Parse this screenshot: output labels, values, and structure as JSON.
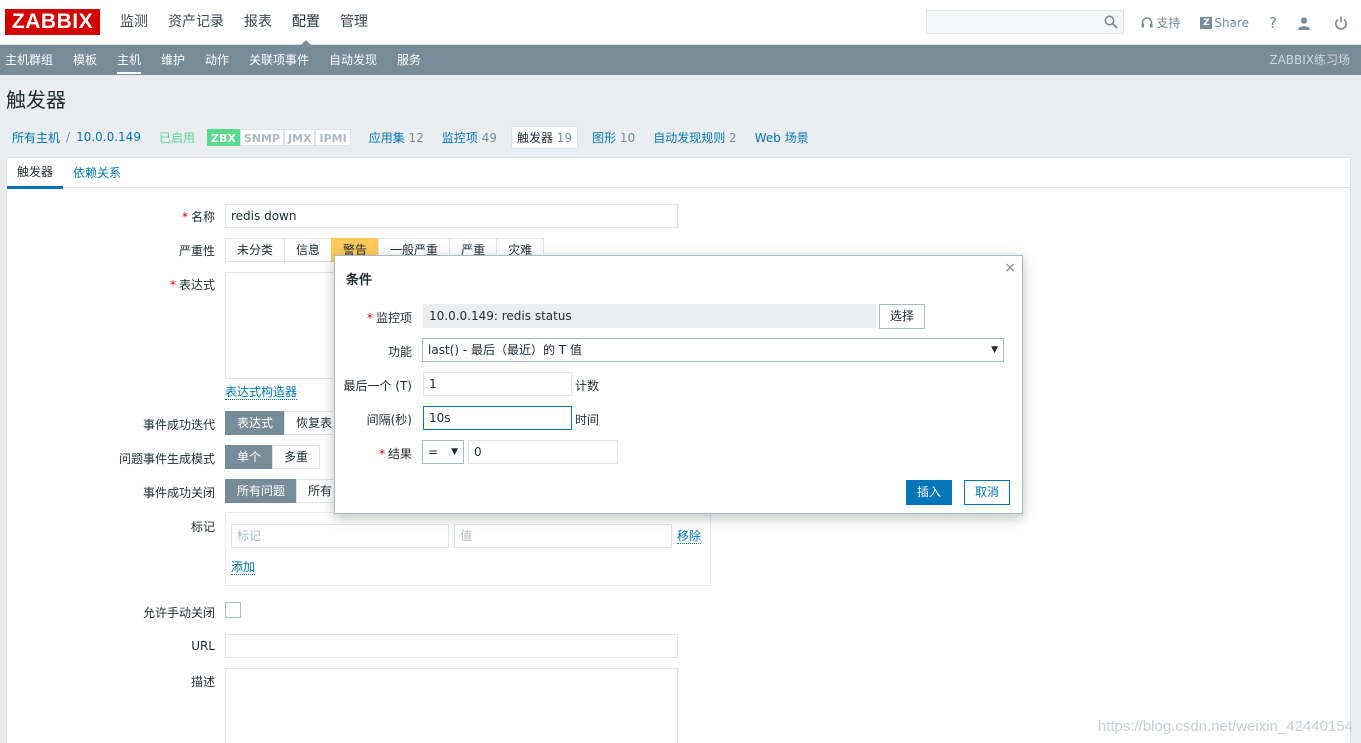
{
  "header": {
    "logo": "ZABBIX",
    "menu": [
      "监测",
      "资产记录",
      "报表",
      "配置",
      "管理"
    ],
    "support": "支持",
    "share": "Share",
    "share_letter": "Z",
    "help": "?"
  },
  "submenu": {
    "items": [
      "主机群组",
      "模板",
      "主机",
      "维护",
      "动作",
      "关联项事件",
      "自动发现",
      "服务"
    ],
    "brand": "ZABBIX练习场"
  },
  "page": {
    "title": "触发器"
  },
  "breadcrumbs": {
    "all_hosts": "所有主机",
    "sep": "/",
    "host": "10.0.0.149",
    "status": "已启用",
    "tags": [
      "ZBX",
      "SNMP",
      "JMX",
      "IPMI"
    ],
    "links": [
      {
        "label": "应用集",
        "count": "12"
      },
      {
        "label": "监控项",
        "count": "49"
      },
      {
        "label": "触发器",
        "count": "19"
      },
      {
        "label": "图形",
        "count": "10"
      },
      {
        "label": "自动发现规则",
        "count": "2"
      },
      {
        "label": "Web 场景",
        "count": ""
      }
    ]
  },
  "tabs": [
    "触发器",
    "依赖关系"
  ],
  "form": {
    "name_label": "名称",
    "name_value": "redis down",
    "severity_label": "严重性",
    "severity_options": [
      "未分类",
      "信息",
      "警告",
      "一般严重",
      "严重",
      "灾难"
    ],
    "expression_label": "表达式",
    "expression_builder": "表达式构造器",
    "ok_event_label": "事件成功迭代",
    "ok_event_options": [
      "表达式",
      "恢复表"
    ],
    "problem_mode_label": "问题事件生成模式",
    "problem_mode_options": [
      "单个",
      "多重"
    ],
    "ok_close_label": "事件成功关闭",
    "ok_close_options": [
      "所有问题",
      "所有"
    ],
    "tags_label": "标记",
    "tag_placeholder": "标记",
    "value_placeholder": "值",
    "remove": "移除",
    "add": "添加",
    "manual_close_label": "允许手动关闭",
    "url_label": "URL",
    "description_label": "描述"
  },
  "dialog": {
    "title": "条件",
    "close": "×",
    "item_label": "监控项",
    "item_value": "10.0.0.149: redis status",
    "select_button": "选择",
    "function_label": "功能",
    "function_value": "last() - 最后（最近）的 T 值",
    "last_label": "最后一个 (T)",
    "last_value": "1",
    "last_unit": "计数",
    "interval_label": "间隔(秒)",
    "interval_value": "10s",
    "interval_unit": "时间",
    "result_label": "结果",
    "result_operator": "=",
    "result_value": "0",
    "insert_button": "插入",
    "cancel_button": "取消"
  },
  "watermark": "https://blog.csdn.net/weixin_42440154"
}
